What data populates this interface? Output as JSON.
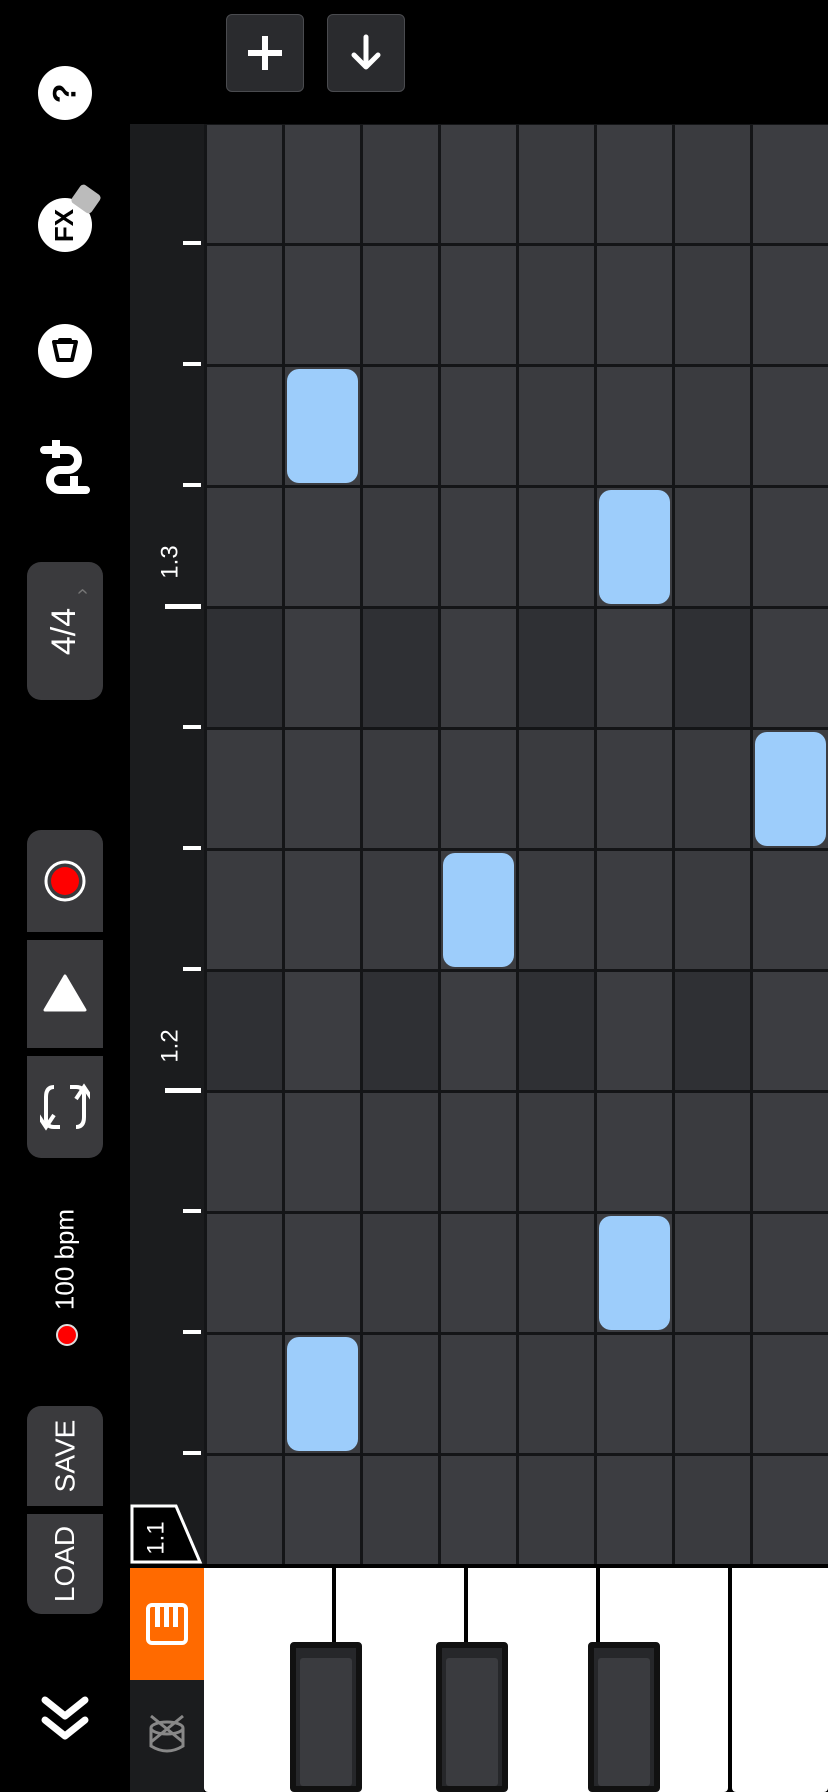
{
  "sidebar": {
    "help_label": "?",
    "fx_label": "FX",
    "time_signature": "4/4",
    "bpm_label": "100 bpm",
    "save_label": "SAVE",
    "load_label": "LOAD"
  },
  "ruler": {
    "bar_labels": [
      "1.3",
      "1.2",
      "1.1"
    ]
  },
  "colors": {
    "note": "#9dcdfb",
    "record": "#ff0000",
    "instrument_active": "#ff6a00",
    "grid_cell": "#3a3b3f"
  },
  "icons": [
    "help-icon",
    "fx-icon",
    "instrument-icon",
    "mixer-icon",
    "chevron-right-icon",
    "record-icon",
    "play-icon",
    "loop-icon",
    "collapse-icon",
    "piano-icon",
    "drum-icon",
    "plus-icon",
    "arrow-down-icon"
  ],
  "notes": [
    {
      "step": 1,
      "row": 2
    },
    {
      "step": 5,
      "row": 3
    },
    {
      "step": 7,
      "row": 5
    },
    {
      "step": 3,
      "row": 6
    },
    {
      "step": 5,
      "row": 9
    },
    {
      "step": 1,
      "row": 10
    }
  ]
}
